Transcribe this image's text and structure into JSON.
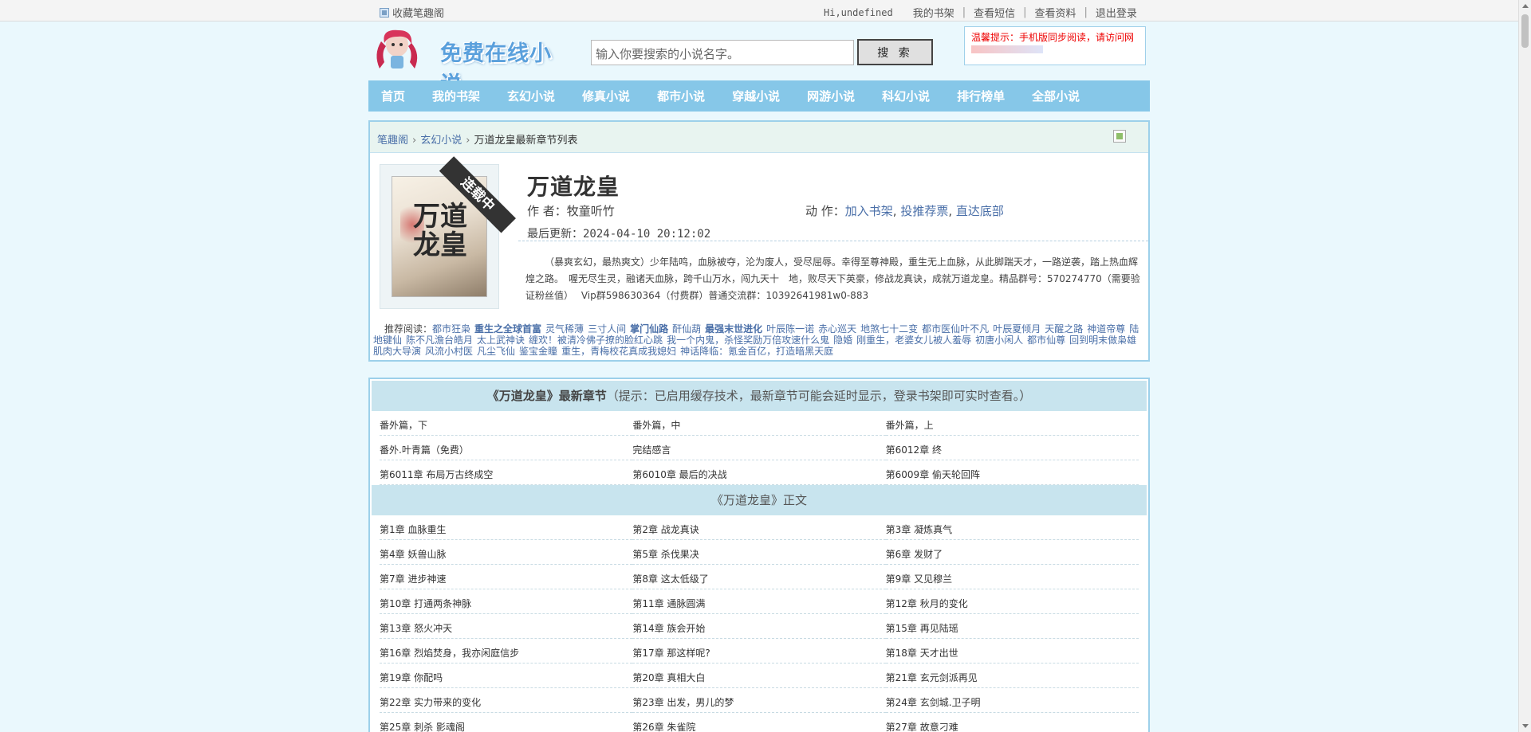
{
  "topbar": {
    "favorite_label": "收藏笔趣阁",
    "greeting": "Hi,undefined",
    "links": [
      "我的书架",
      "查看短信",
      "查看资料",
      "退出登录"
    ]
  },
  "header": {
    "logo_text": "免费在线小说",
    "search_placeholder": "输入你要搜索的小说名字。",
    "search_button": "搜 索",
    "tip": "温馨提示：手机版同步阅读，请访问网"
  },
  "nav": [
    "首页",
    "我的书架",
    "玄幻小说",
    "修真小说",
    "都市小说",
    "穿越小说",
    "网游小说",
    "科幻小说",
    "排行榜单",
    "全部小说"
  ],
  "breadcrumb": {
    "home": "笔趣阁",
    "category": "玄幻小说",
    "current": "万道龙皇最新章节列表"
  },
  "book": {
    "ribbon": "连载中",
    "cover_title": "万道龙皇",
    "title": "万道龙皇",
    "author_label": "作 者：",
    "author": "牧童听竹",
    "action_label": "动 作：",
    "actions": [
      "加入书架",
      "投推荐票",
      "直达底部"
    ],
    "updated_label": "最后更新：",
    "updated": "2024-04-10 20:12:02",
    "intro": "（暴爽玄幻，最热爽文）少年陆鸣，血脉被夺，沦为废人，受尽屈辱。幸得至尊神殿，重生无上血脉，从此脚踹天才，一路逆袭，踏上热血辉煌之路。　喔无尽生灵，融诸天血脉，跨千山万水，闯九天十　地，败尽天下英豪，修战龙真诀，成就万道龙皇。精品群号：570274770（需要验证粉丝值）　 Vip群598630364（付费群）普通交流群：10392641981w0-883"
  },
  "recommend": {
    "label": "推荐阅读：",
    "items": [
      {
        "t": "都市狂枭",
        "b": false
      },
      {
        "t": "重生之全球首富",
        "b": true
      },
      {
        "t": "灵气稀薄",
        "b": false
      },
      {
        "t": "三寸人间",
        "b": false
      },
      {
        "t": "掌门仙路",
        "b": true
      },
      {
        "t": "酐仙葫",
        "b": false
      },
      {
        "t": "最强末世进化",
        "b": true
      },
      {
        "t": "叶辰陈一诺",
        "b": false
      },
      {
        "t": "赤心巡天",
        "b": false
      },
      {
        "t": "地煞七十二变",
        "b": false
      },
      {
        "t": "都市医仙叶不凡",
        "b": false
      },
      {
        "t": "叶辰夏倾月",
        "b": false
      },
      {
        "t": "天醒之路",
        "b": false
      },
      {
        "t": "神道帝尊",
        "b": false
      },
      {
        "t": "陆地键仙",
        "b": false
      },
      {
        "t": "陈不凡澹台皓月",
        "b": false
      },
      {
        "t": "太上武神诀",
        "b": false
      },
      {
        "t": "缠欢！被清冷佛子撩的脸红心跳",
        "b": false
      },
      {
        "t": "我一个内鬼，杀怪奖励万倍攻速什么鬼",
        "b": false
      },
      {
        "t": "隐婚",
        "b": false
      },
      {
        "t": "刚重生，老婆女儿被人羞辱",
        "b": false
      },
      {
        "t": "初唐小闲人",
        "b": false
      },
      {
        "t": "都市仙尊",
        "b": false
      },
      {
        "t": "回到明末做枭雄",
        "b": false
      },
      {
        "t": "肌肉大导演",
        "b": false
      },
      {
        "t": "风流小村医",
        "b": false
      },
      {
        "t": "凡尘飞仙",
        "b": false
      },
      {
        "t": "鉴宝金瞳",
        "b": false
      },
      {
        "t": "重生，青梅校花真成我媳妇",
        "b": false
      },
      {
        "t": "神话降临：氪金百亿，打造暗黑天庭",
        "b": false
      }
    ]
  },
  "latest": {
    "title": "《万道龙皇》最新章节",
    "tip": "（提示：已启用缓存技术，最新章节可能会延时显示，登录书架即可实时查看。）",
    "chapters": [
      "番外篇，下",
      "番外篇，中",
      "番外篇，上",
      "番外.叶青篇（免费）",
      "完结感言",
      "第6012章 终",
      "第6011章 布局万古终成空",
      "第6010章 最后的决战",
      "第6009章 偷天轮回阵"
    ]
  },
  "main": {
    "title": "《万道龙皇》正文",
    "chapters": [
      "第1章 血脉重生",
      "第2章 战龙真诀",
      "第3章 凝炼真气",
      "第4章 妖兽山脉",
      "第5章 杀伐果决",
      "第6章 发财了",
      "第7章 进步神速",
      "第8章 这太低级了",
      "第9章 又见穆兰",
      "第10章 打通两条神脉",
      "第11章 通脉圆满",
      "第12章 秋月的变化",
      "第13章 怒火冲天",
      "第14章 族会开始",
      "第15章 再见陆瑶",
      "第16章 烈焰焚身，我亦闲庭信步",
      "第17章 那这样呢?",
      "第18章 天才出世",
      "第19章 你配吗",
      "第20章 真相大白",
      "第21章 玄元剑派再见",
      "第22章 实力带来的变化",
      "第23章 出发，男儿的梦",
      "第24章 玄剑城.卫子明",
      "第25章 刺杀 影魂阁",
      "第26章 朱雀院",
      "第27章 故意刁难"
    ]
  },
  "colors": {
    "page_bg": "#eaf8fd",
    "nav_bg": "#86c7e8",
    "link": "#4a6fa8",
    "tip_red": "#ee0000"
  }
}
